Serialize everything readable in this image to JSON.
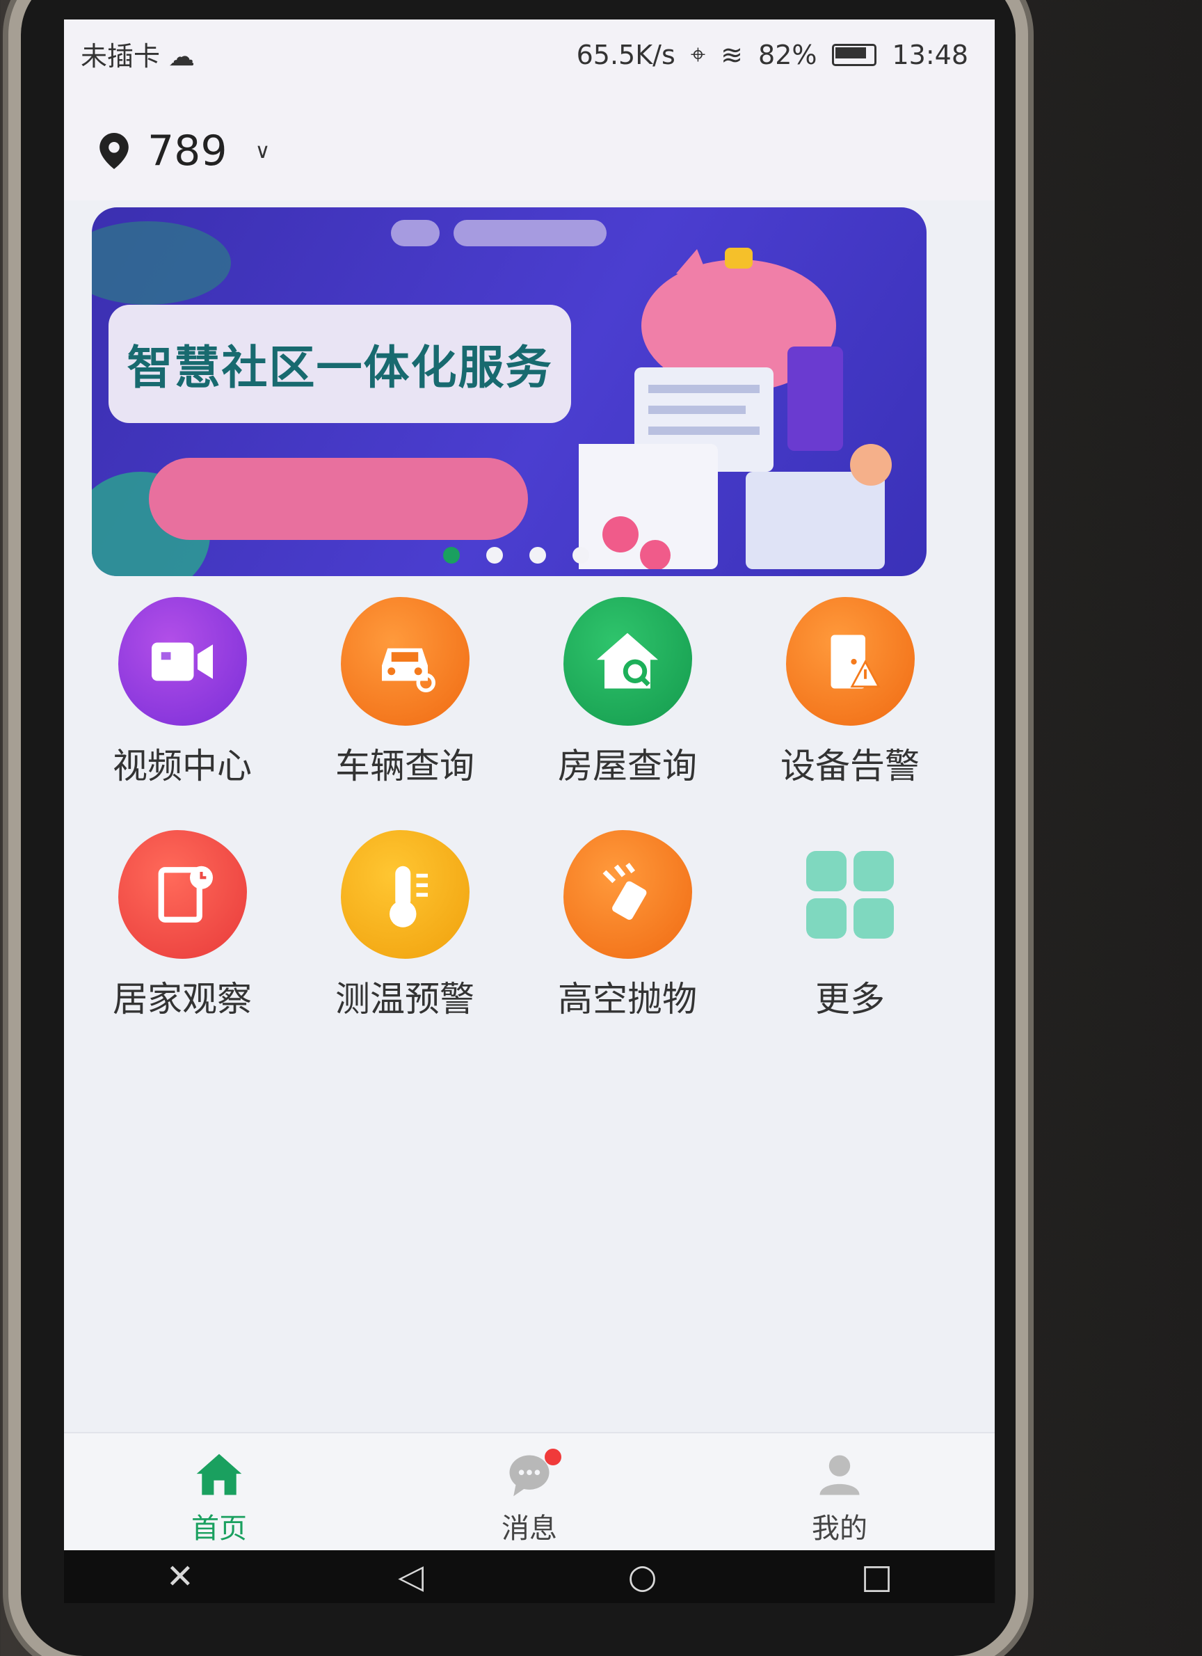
{
  "status_bar": {
    "carrier": "未插卡",
    "speed": "65.5K/s",
    "battery": "82%",
    "time": "13:48"
  },
  "location": {
    "value": "789"
  },
  "banner": {
    "title": "智慧社区一体化服务",
    "slide_count": 4,
    "active_slide": 1
  },
  "services": [
    {
      "label": "视频中心",
      "icon": "video-icon",
      "color": "#8a38e0"
    },
    {
      "label": "车辆查询",
      "icon": "car-search-icon",
      "color": "#f47a1c"
    },
    {
      "label": "房屋查询",
      "icon": "house-search-icon",
      "color": "#1eb05a"
    },
    {
      "label": "设备告警",
      "icon": "device-alarm-icon",
      "color": "#f47a1c"
    },
    {
      "label": "居家观察",
      "icon": "home-observe-icon",
      "color": "#ee4a44"
    },
    {
      "label": "测温预警",
      "icon": "thermometer-icon",
      "color": "#f5b01a"
    },
    {
      "label": "高空抛物",
      "icon": "falling-object-icon",
      "color": "#f47a1c"
    },
    {
      "label": "更多",
      "icon": "more-grid-icon",
      "color": "#7fd8bf"
    }
  ],
  "tabbar": {
    "home": "首页",
    "messages": "消息",
    "mine": "我的",
    "accent": "#1aa05f"
  }
}
